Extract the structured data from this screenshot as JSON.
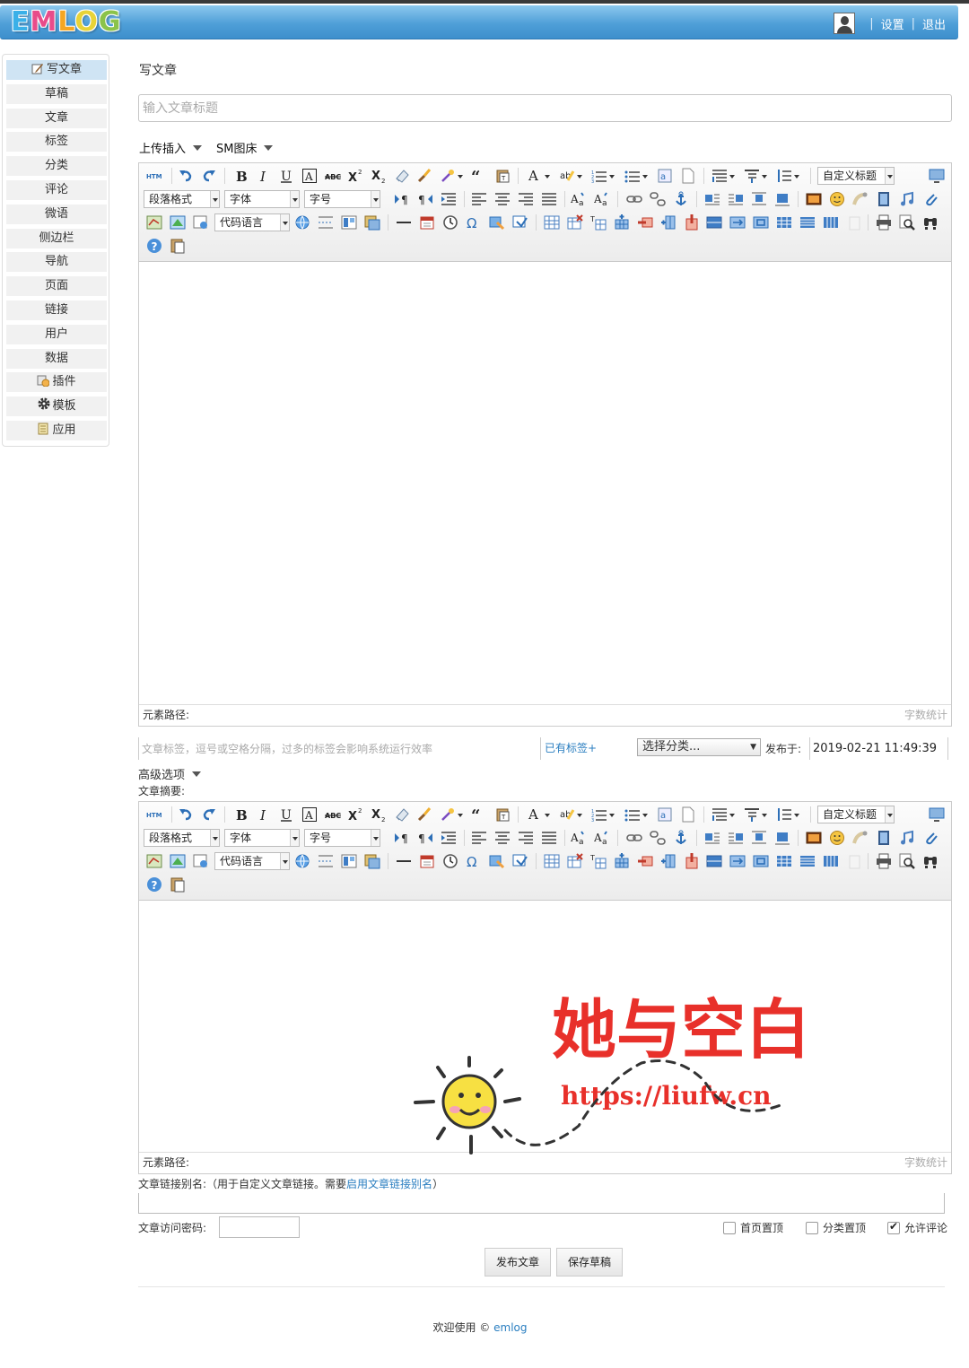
{
  "header": {
    "logo_text": "EMLOG",
    "logo_colors": [
      "#3ab0e8",
      "#e84c8a",
      "#f5a623",
      "#e8d338",
      "#8bc34a"
    ],
    "settings_label": "设置",
    "logout_label": "退出",
    "separator": "|"
  },
  "sidebar": {
    "items": [
      {
        "label": "写文章",
        "icon": "pencil-icon",
        "active": true
      },
      {
        "label": "草稿"
      },
      {
        "label": "文章"
      },
      {
        "label": "标签"
      },
      {
        "label": "分类"
      },
      {
        "label": "评论"
      },
      {
        "label": "微语"
      },
      {
        "label": "侧边栏"
      },
      {
        "label": "导航"
      },
      {
        "label": "页面"
      },
      {
        "label": "链接"
      },
      {
        "label": "用户"
      },
      {
        "label": "数据"
      },
      {
        "label": "插件",
        "icon": "plugin-icon"
      },
      {
        "label": "模板",
        "icon": "gear-icon"
      },
      {
        "label": "应用",
        "icon": "app-icon"
      }
    ]
  },
  "main": {
    "title": "写文章",
    "title_placeholder": "输入文章标题",
    "upload_insert_label": "上传插入",
    "sm_gallery_label": "SM图床"
  },
  "editor": {
    "format_select": "段落格式",
    "font_select": "字体",
    "size_select": "字号",
    "code_lang_select": "代码语言",
    "custom_title_select": "自定义标题",
    "path_label": "元素路径:",
    "word_count_label": "字数统计"
  },
  "meta": {
    "tag_placeholder": "文章标签，逗号或空格分隔，过多的标签会影响系统运行效率",
    "existing_tags_label": "已有标签+",
    "category_select": "选择分类...",
    "publish_at_label": "发布于:",
    "publish_at_value": "2019-02-21 11:49:39",
    "advanced_label": "高级选项",
    "summary_label": "文章摘要:",
    "alias_label_prefix": "文章链接别名:（用于自定义文章链接。需要",
    "alias_link": "启用文章链接别名",
    "alias_label_suffix": "）",
    "password_label": "文章访问密码:",
    "checkbox_top": "首页置顶",
    "checkbox_sort_top": "分类置顶",
    "checkbox_allow_comment": "允许评论",
    "allow_comment_checked": true,
    "publish_button": "发布文章",
    "save_draft_button": "保存草稿"
  },
  "footer": {
    "prefix": "欢迎使用 ©",
    "link": "emlog"
  },
  "watermark": {
    "title": "她与空白",
    "url": "https://liufw.cn"
  }
}
